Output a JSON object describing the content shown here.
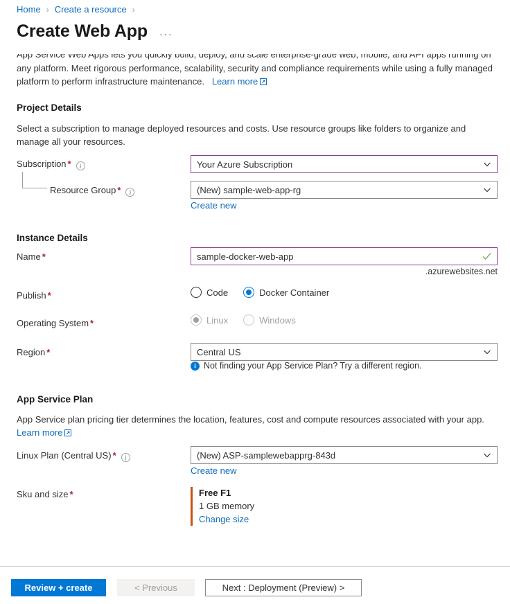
{
  "breadcrumb": {
    "items": [
      {
        "label": "Home"
      },
      {
        "label": "Create a resource"
      }
    ],
    "separator": "›"
  },
  "header": {
    "title": "Create Web App",
    "more_menu": "···"
  },
  "description": {
    "text": "App Service Web Apps lets you quickly build, deploy, and scale enterprise-grade web, mobile, and API apps running on any platform. Meet rigorous performance, scalability, security and compliance requirements while using a fully managed platform to perform infrastructure maintenance.",
    "learn_more": "Learn more"
  },
  "project_details": {
    "heading": "Project Details",
    "description": "Select a subscription to manage deployed resources and costs. Use resource groups like folders to organize and manage all your resources.",
    "subscription": {
      "label": "Subscription",
      "required": "*",
      "value": "Your Azure Subscription"
    },
    "resource_group": {
      "label": "Resource Group",
      "required": "*",
      "value": "(New) sample-web-app-rg",
      "create_new": "Create new"
    }
  },
  "instance_details": {
    "heading": "Instance Details",
    "name": {
      "label": "Name",
      "required": "*",
      "value": "sample-docker-web-app",
      "suffix": ".azurewebsites.net"
    },
    "publish": {
      "label": "Publish",
      "required": "*",
      "options": [
        {
          "label": "Code",
          "checked": false
        },
        {
          "label": "Docker Container",
          "checked": true
        }
      ]
    },
    "operating_system": {
      "label": "Operating System",
      "required": "*",
      "options": [
        {
          "label": "Linux",
          "checked": true
        },
        {
          "label": "Windows",
          "checked": false
        }
      ]
    },
    "region": {
      "label": "Region",
      "required": "*",
      "value": "Central US",
      "hint": "Not finding your App Service Plan? Try a different region.",
      "hint_icon": "i"
    }
  },
  "app_service_plan": {
    "heading": "App Service Plan",
    "description": "App Service plan pricing tier determines the location, features, cost and compute resources associated with your app.",
    "learn_more": "Learn more",
    "linux_plan": {
      "label": "Linux Plan (Central US)",
      "required": "*",
      "value": "(New) ASP-samplewebapprg-843d",
      "create_new": "Create new"
    },
    "sku": {
      "label": "Sku and size",
      "required": "*",
      "tier": "Free F1",
      "memory": "1 GB memory",
      "change_link": "Change size"
    }
  },
  "footer": {
    "review_create": "Review + create",
    "previous": "< Previous",
    "next": "Next : Deployment (Preview) >"
  },
  "colors": {
    "accent": "#0078d4",
    "link": "#0f6cbd",
    "focus_border": "#8d3b8f",
    "required": "#a4262c",
    "sku_accent": "#ca5010",
    "valid_check": "#6aa84f"
  }
}
